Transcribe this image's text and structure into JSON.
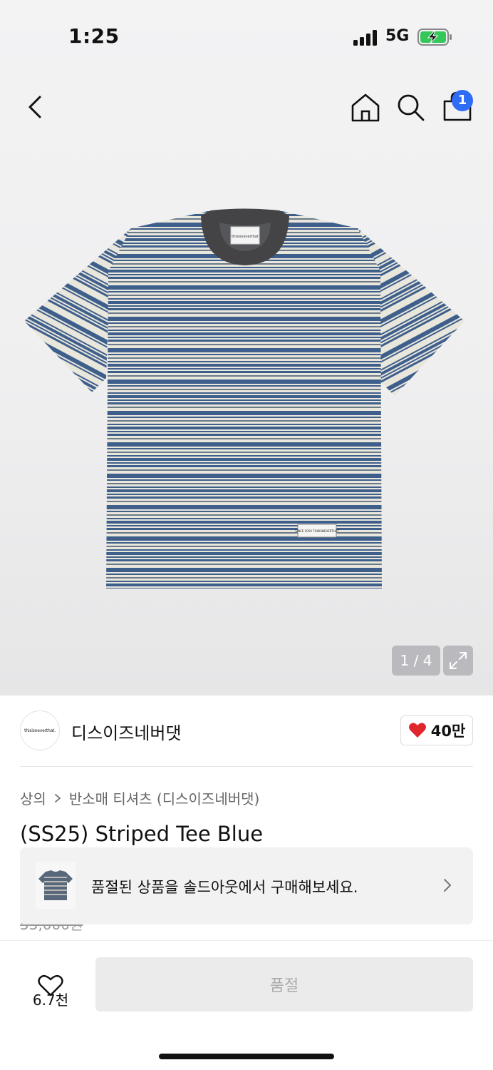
{
  "status_bar": {
    "time": "1:25",
    "network": "5G",
    "battery_charging": true
  },
  "nav": {
    "cart_count": "1",
    "icons": [
      "back-icon",
      "home-icon",
      "search-icon",
      "cart-icon"
    ]
  },
  "gallery": {
    "counter": "1 / 4",
    "neck_label": "thisisneverthat",
    "hem_label": "SINCE 2010\nTHISISNEVERTHAT\nINTERNATIONAL"
  },
  "brand": {
    "logo_text": "thisisneverthat.",
    "name": "디스이즈네버댓",
    "likes": "40만",
    "like_color": "#e0262d"
  },
  "breadcrumb": {
    "category": "상의",
    "subcategory": "반소매 티셔츠 (디스이즈네버댓)"
  },
  "product": {
    "title": "(SS25) Striped Tee Blue",
    "original_price": "55,000원"
  },
  "banner": {
    "text": "품절된 상품을 솔드아웃에서 구매해보세요."
  },
  "bottom_bar": {
    "wish_count": "6.7천",
    "action_label": "품절"
  },
  "colors": {
    "accent_blue": "#2f6cf5",
    "stripe_blue": "#3e5f8c",
    "stripe_cream": "#e9e6dc",
    "collar": "#444447"
  }
}
